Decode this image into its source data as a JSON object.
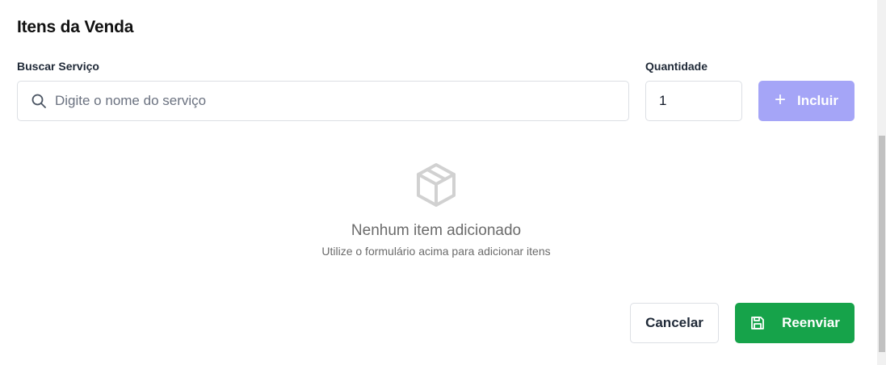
{
  "section": {
    "title": "Itens da Venda"
  },
  "search": {
    "label": "Buscar Serviço",
    "placeholder": "Digite o nome do serviço",
    "icon": "search-icon"
  },
  "quantity": {
    "label": "Quantidade",
    "value": "1"
  },
  "include_button": {
    "icon": "plus-icon",
    "label": "Incluir",
    "color": "#a5a5f7"
  },
  "empty_state": {
    "icon": "box-icon",
    "title": "Nenhum item adicionado",
    "subtitle": "Utilize o formulário acima para adicionar itens"
  },
  "actions": {
    "cancel_label": "Cancelar",
    "resend_label": "Reenviar",
    "resend_icon": "save-icon",
    "resend_color": "#16a34a"
  }
}
